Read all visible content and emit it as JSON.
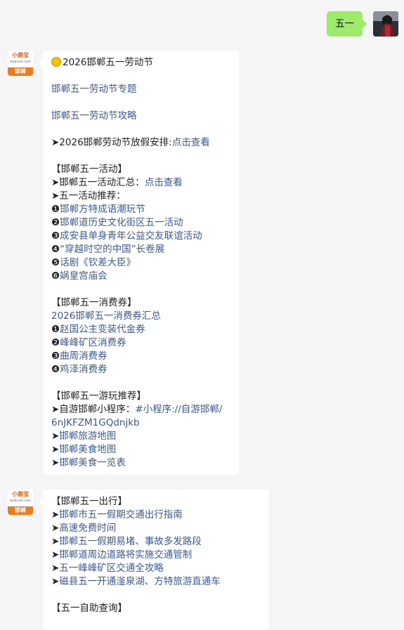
{
  "user_message": {
    "text": "五一"
  },
  "bot_avatar": {
    "brand": "小鹿宝",
    "domain": "lexdcom.com",
    "city": "邯郸"
  },
  "message1": {
    "title": "2026邯郸五一劳动节",
    "link_topic": "邯郸五一劳动节专题",
    "link_guide": "邯郸五一劳动节攻略",
    "holiday_prefix": "➤2026邯郸劳动节放假安排:",
    "holiday_link": "点击查看",
    "activities_header": "【邯郸五一活动】",
    "activities_summary_prefix": "➤邯郸五一活动汇总：",
    "activities_summary_link": "点击查看",
    "recommend_label": "➤五一活动推荐：",
    "activities": [
      {
        "num": "❶",
        "text": "邯郸方特成语潮玩节"
      },
      {
        "num": "❷",
        "text": "邯郸道历史文化街区五一活动"
      },
      {
        "num": "❸",
        "text": "成安县单身青年公益交友联谊活动"
      },
      {
        "num": "❹",
        "text": "“穿越时空的中国”长卷展"
      },
      {
        "num": "❺",
        "text": "话剧《钦差大臣》"
      },
      {
        "num": "❻",
        "text": "娲皇宫庙会"
      }
    ],
    "coupons_header": "【邯郸五一消费券】",
    "coupons_summary": "2026邯郸五一消费券汇总",
    "coupons": [
      {
        "num": "❶",
        "text": "赵国公主变装代金券"
      },
      {
        "num": "❷",
        "text": "峰峰矿区消费券"
      },
      {
        "num": "❸",
        "text": "曲周消费券"
      },
      {
        "num": "❹",
        "text": "鸡泽消费券"
      }
    ],
    "play_header": "【邯郸五一游玩推荐】",
    "miniprogram_prefix": "➤自游邯郸小程序：",
    "miniprogram_link1": "#小程序://自游邯郸/",
    "miniprogram_link2": "6nJKFZM1GQdnjkb",
    "play_items": [
      {
        "arrow": "➤",
        "text": "邯郸旅游地图"
      },
      {
        "arrow": "➤",
        "text": "邯郸美食地图"
      },
      {
        "arrow": "➤",
        "text": "邯郸美食一览表"
      }
    ]
  },
  "message2": {
    "travel_header": "【邯郸五一出行】",
    "travel_items": [
      {
        "arrow": "➤",
        "text": "邯郸市五一假期交通出行指南"
      },
      {
        "arrow": "➤",
        "text": "高速免费时间"
      },
      {
        "arrow": "➤",
        "text": "邯郸五一假期易堵、事故多发路段"
      },
      {
        "arrow": "➤",
        "text": "邯郸道周边道路将实施交通管制"
      },
      {
        "arrow": "➤",
        "text": "五一峰峰矿区交通全攻略"
      },
      {
        "arrow": "➤",
        "text": "磁县五一开通滏泉湖、方特旅游直通车"
      }
    ],
    "self_query_header": "【五一自助查询】"
  }
}
